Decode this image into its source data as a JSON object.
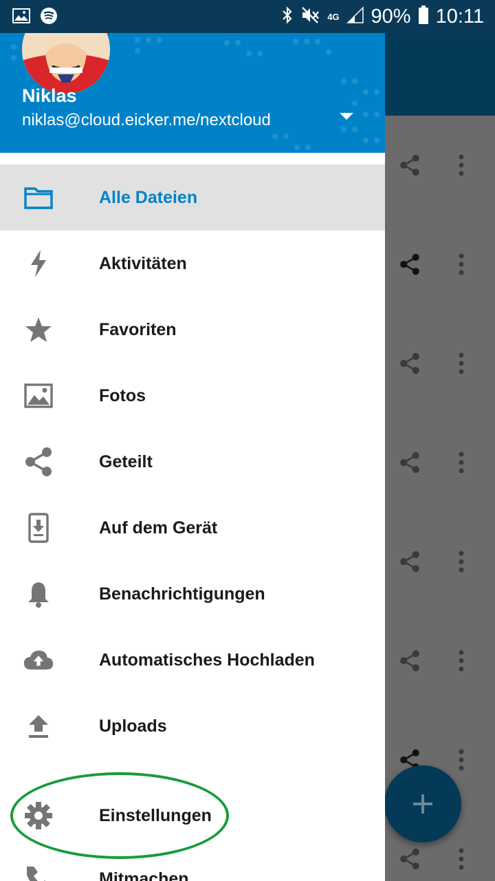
{
  "status_bar": {
    "battery": "90%",
    "time": "10:11",
    "network": "4G"
  },
  "drawer": {
    "account": {
      "name": "Niklas",
      "url": "niklas@cloud.eicker.me/nextcloud"
    },
    "menu": [
      {
        "label": "Alle Dateien",
        "icon": "folder-icon",
        "active": true
      },
      {
        "label": "Aktivitäten",
        "icon": "lightning-icon"
      },
      {
        "label": "Favoriten",
        "icon": "star-icon"
      },
      {
        "label": "Fotos",
        "icon": "image-icon"
      },
      {
        "label": "Geteilt",
        "icon": "share-icon"
      },
      {
        "label": "Auf dem Gerät",
        "icon": "phone-download-icon"
      },
      {
        "label": "Benachrichtigungen",
        "icon": "bell-icon"
      },
      {
        "label": "Automatisches Hochladen",
        "icon": "cloud-upload-icon"
      },
      {
        "label": "Uploads",
        "icon": "upload-icon"
      },
      {
        "label": "Einstellungen",
        "icon": "gear-icon"
      },
      {
        "label": "Mitmachen",
        "icon": "handshake-icon"
      }
    ]
  },
  "colors": {
    "accent": "#0082c9",
    "status_bar": "#0a3a58",
    "highlight": "#1a9b3a"
  }
}
